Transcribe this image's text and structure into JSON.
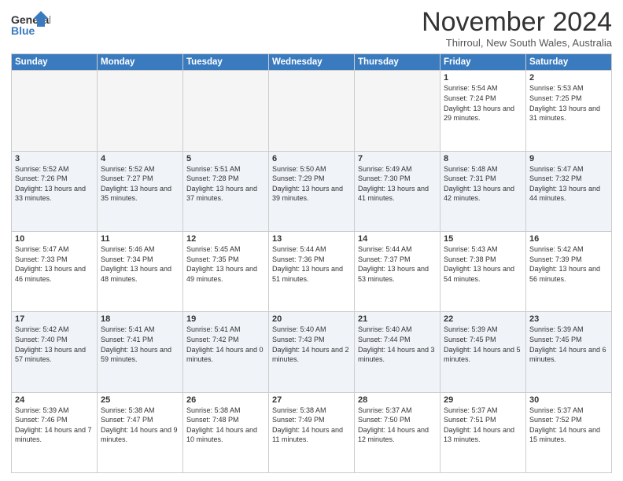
{
  "logo": {
    "line1": "General",
    "line2": "Blue"
  },
  "header": {
    "month": "November 2024",
    "location": "Thirroul, New South Wales, Australia"
  },
  "days_of_week": [
    "Sunday",
    "Monday",
    "Tuesday",
    "Wednesday",
    "Thursday",
    "Friday",
    "Saturday"
  ],
  "weeks": [
    [
      {
        "day": "",
        "info": ""
      },
      {
        "day": "",
        "info": ""
      },
      {
        "day": "",
        "info": ""
      },
      {
        "day": "",
        "info": ""
      },
      {
        "day": "",
        "info": ""
      },
      {
        "day": "1",
        "info": "Sunrise: 5:54 AM\nSunset: 7:24 PM\nDaylight: 13 hours and 29 minutes."
      },
      {
        "day": "2",
        "info": "Sunrise: 5:53 AM\nSunset: 7:25 PM\nDaylight: 13 hours and 31 minutes."
      }
    ],
    [
      {
        "day": "3",
        "info": "Sunrise: 5:52 AM\nSunset: 7:26 PM\nDaylight: 13 hours and 33 minutes."
      },
      {
        "day": "4",
        "info": "Sunrise: 5:52 AM\nSunset: 7:27 PM\nDaylight: 13 hours and 35 minutes."
      },
      {
        "day": "5",
        "info": "Sunrise: 5:51 AM\nSunset: 7:28 PM\nDaylight: 13 hours and 37 minutes."
      },
      {
        "day": "6",
        "info": "Sunrise: 5:50 AM\nSunset: 7:29 PM\nDaylight: 13 hours and 39 minutes."
      },
      {
        "day": "7",
        "info": "Sunrise: 5:49 AM\nSunset: 7:30 PM\nDaylight: 13 hours and 41 minutes."
      },
      {
        "day": "8",
        "info": "Sunrise: 5:48 AM\nSunset: 7:31 PM\nDaylight: 13 hours and 42 minutes."
      },
      {
        "day": "9",
        "info": "Sunrise: 5:47 AM\nSunset: 7:32 PM\nDaylight: 13 hours and 44 minutes."
      }
    ],
    [
      {
        "day": "10",
        "info": "Sunrise: 5:47 AM\nSunset: 7:33 PM\nDaylight: 13 hours and 46 minutes."
      },
      {
        "day": "11",
        "info": "Sunrise: 5:46 AM\nSunset: 7:34 PM\nDaylight: 13 hours and 48 minutes."
      },
      {
        "day": "12",
        "info": "Sunrise: 5:45 AM\nSunset: 7:35 PM\nDaylight: 13 hours and 49 minutes."
      },
      {
        "day": "13",
        "info": "Sunrise: 5:44 AM\nSunset: 7:36 PM\nDaylight: 13 hours and 51 minutes."
      },
      {
        "day": "14",
        "info": "Sunrise: 5:44 AM\nSunset: 7:37 PM\nDaylight: 13 hours and 53 minutes."
      },
      {
        "day": "15",
        "info": "Sunrise: 5:43 AM\nSunset: 7:38 PM\nDaylight: 13 hours and 54 minutes."
      },
      {
        "day": "16",
        "info": "Sunrise: 5:42 AM\nSunset: 7:39 PM\nDaylight: 13 hours and 56 minutes."
      }
    ],
    [
      {
        "day": "17",
        "info": "Sunrise: 5:42 AM\nSunset: 7:40 PM\nDaylight: 13 hours and 57 minutes."
      },
      {
        "day": "18",
        "info": "Sunrise: 5:41 AM\nSunset: 7:41 PM\nDaylight: 13 hours and 59 minutes."
      },
      {
        "day": "19",
        "info": "Sunrise: 5:41 AM\nSunset: 7:42 PM\nDaylight: 14 hours and 0 minutes."
      },
      {
        "day": "20",
        "info": "Sunrise: 5:40 AM\nSunset: 7:43 PM\nDaylight: 14 hours and 2 minutes."
      },
      {
        "day": "21",
        "info": "Sunrise: 5:40 AM\nSunset: 7:44 PM\nDaylight: 14 hours and 3 minutes."
      },
      {
        "day": "22",
        "info": "Sunrise: 5:39 AM\nSunset: 7:45 PM\nDaylight: 14 hours and 5 minutes."
      },
      {
        "day": "23",
        "info": "Sunrise: 5:39 AM\nSunset: 7:45 PM\nDaylight: 14 hours and 6 minutes."
      }
    ],
    [
      {
        "day": "24",
        "info": "Sunrise: 5:39 AM\nSunset: 7:46 PM\nDaylight: 14 hours and 7 minutes."
      },
      {
        "day": "25",
        "info": "Sunrise: 5:38 AM\nSunset: 7:47 PM\nDaylight: 14 hours and 9 minutes."
      },
      {
        "day": "26",
        "info": "Sunrise: 5:38 AM\nSunset: 7:48 PM\nDaylight: 14 hours and 10 minutes."
      },
      {
        "day": "27",
        "info": "Sunrise: 5:38 AM\nSunset: 7:49 PM\nDaylight: 14 hours and 11 minutes."
      },
      {
        "day": "28",
        "info": "Sunrise: 5:37 AM\nSunset: 7:50 PM\nDaylight: 14 hours and 12 minutes."
      },
      {
        "day": "29",
        "info": "Sunrise: 5:37 AM\nSunset: 7:51 PM\nDaylight: 14 hours and 13 minutes."
      },
      {
        "day": "30",
        "info": "Sunrise: 5:37 AM\nSunset: 7:52 PM\nDaylight: 14 hours and 15 minutes."
      }
    ]
  ]
}
